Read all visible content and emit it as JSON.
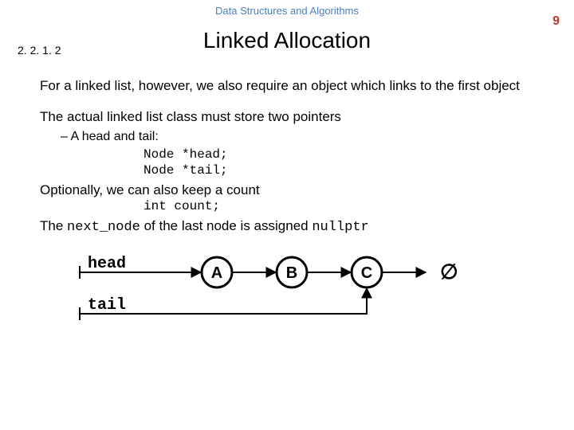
{
  "header": "Data Structures and Algorithms",
  "page_number": "9",
  "section_number": "2. 2. 1. 2",
  "title": "Linked Allocation",
  "para1": "For a linked list, however, we also require an object which links to the first object",
  "para2": "The actual linked list class must store two pointers",
  "bullet1": "A head and tail:",
  "code1": "Node *head;",
  "code2": "Node *tail;",
  "para3": "Optionally, we can also keep a count",
  "code3": "int count;",
  "para4_a": "The ",
  "para4_code1": "next_node",
  "para4_b": " of the last node is assigned ",
  "para4_code2": "nullptr",
  "diagram": {
    "head_label": "head",
    "tail_label": "tail",
    "nodes": {
      "a": "A",
      "b": "B",
      "c": "C"
    },
    "null_glyph": "∅"
  }
}
